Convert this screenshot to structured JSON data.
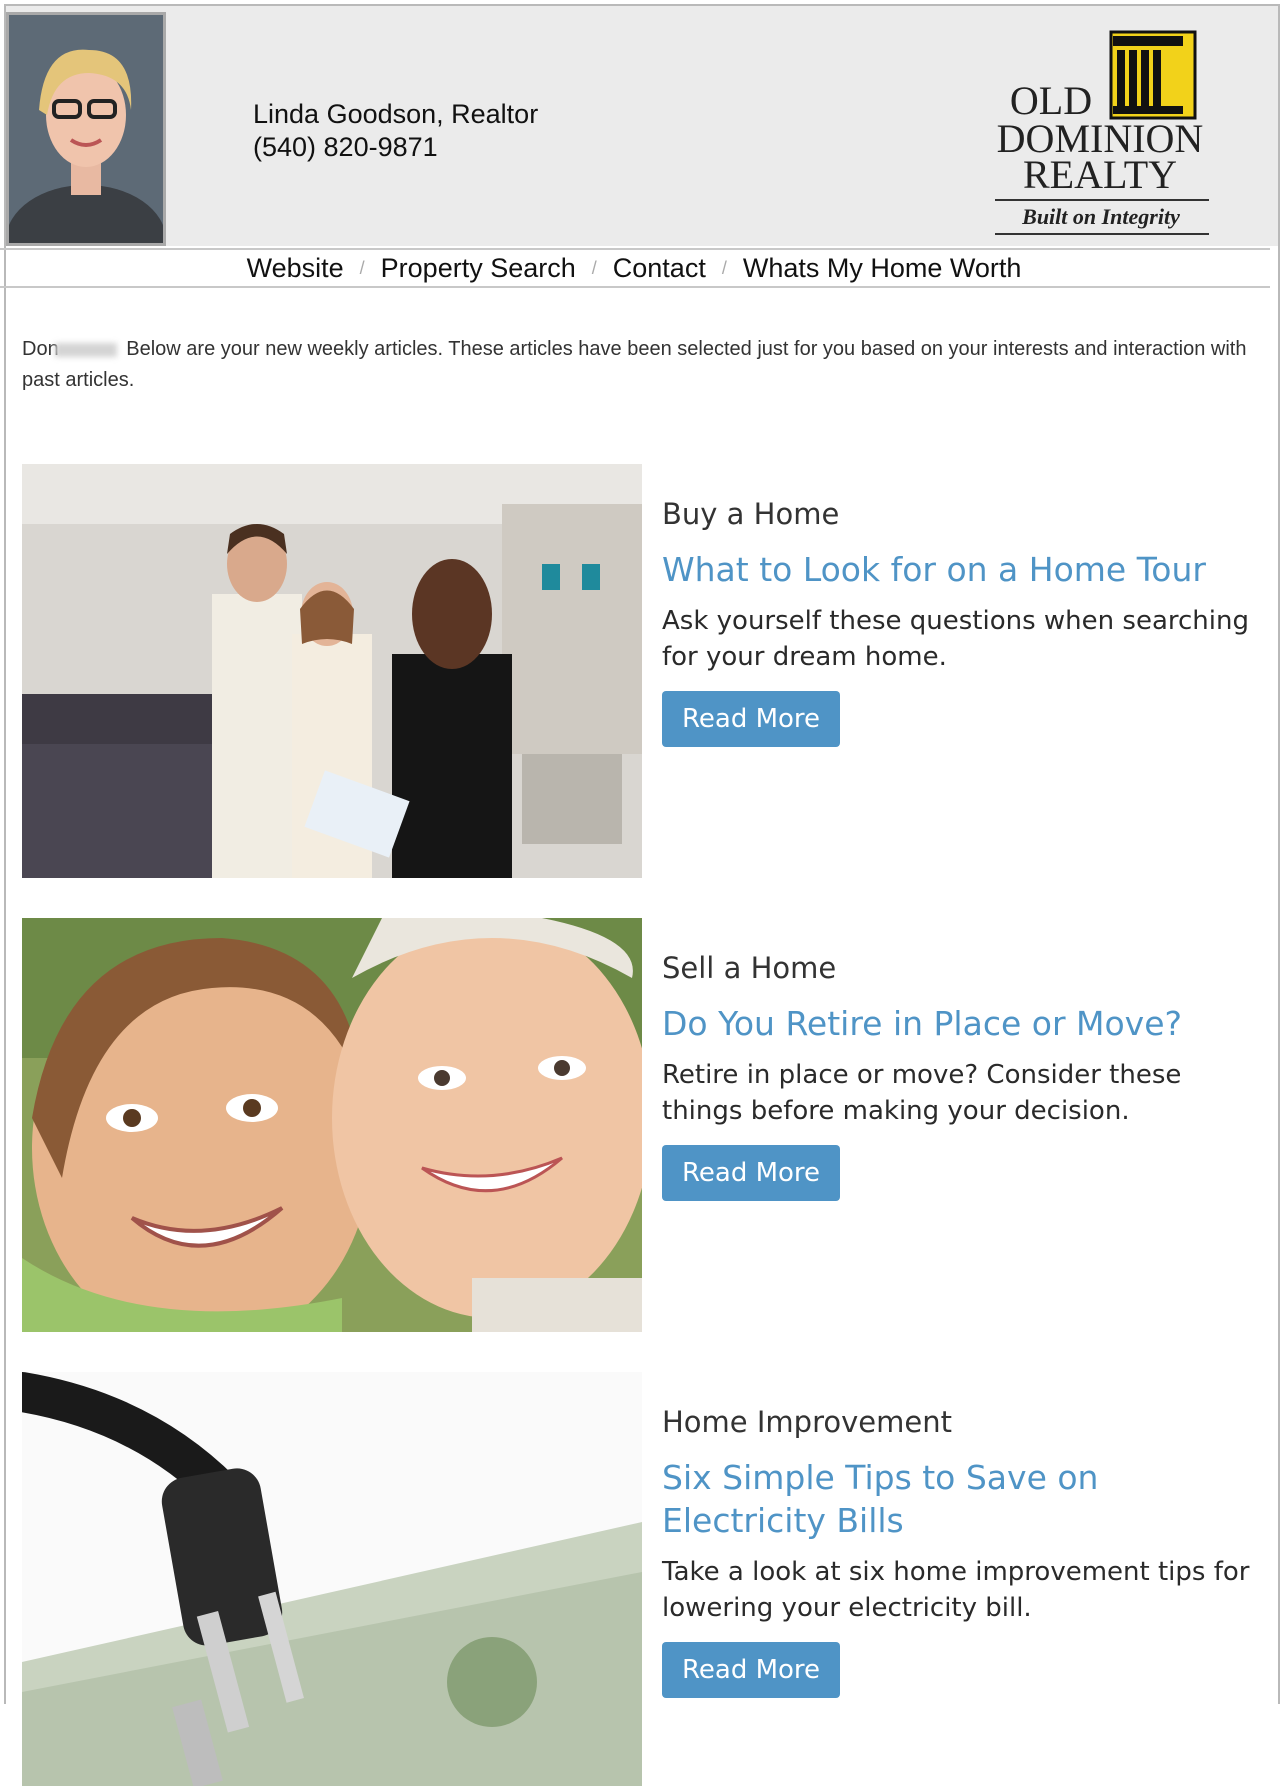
{
  "agent": {
    "name": "Linda Goodson, Realtor",
    "phone": "(540) 820-9871"
  },
  "brand": {
    "line1": "OLD",
    "line2": "DOMINION",
    "line3": "REALTY",
    "tagline": "Built on Integrity",
    "accent_color": "#f2d21a"
  },
  "nav": {
    "items": [
      {
        "label": "Website"
      },
      {
        "label": "Property Search"
      },
      {
        "label": "Contact"
      },
      {
        "label": "Whats My Home Worth"
      }
    ],
    "separator": "/"
  },
  "intro": {
    "greeting": "Don",
    "text": "Below are your new weekly articles. These articles have been selected just for you based on your interests and interaction with past articles."
  },
  "articles": [
    {
      "category": "Buy a Home",
      "title": "What to Look for on a Home Tour",
      "description": "Ask yourself these questions when searching for your dream home.",
      "button_label": "Read More"
    },
    {
      "category": "Sell a Home",
      "title": "Do You Retire in Place or Move?",
      "description": "Retire in place or move? Consider these things before making your decision.",
      "button_label": "Read More"
    },
    {
      "category": "Home Improvement",
      "title": "Six Simple Tips to Save on Electricity Bills",
      "description": "Take a look at six home improvement tips for lowering your electricity bill.",
      "button_label": "Read More"
    }
  ],
  "colors": {
    "link": "#4f94c6",
    "button": "#4f94c6",
    "header_bg": "#ebebeb"
  }
}
